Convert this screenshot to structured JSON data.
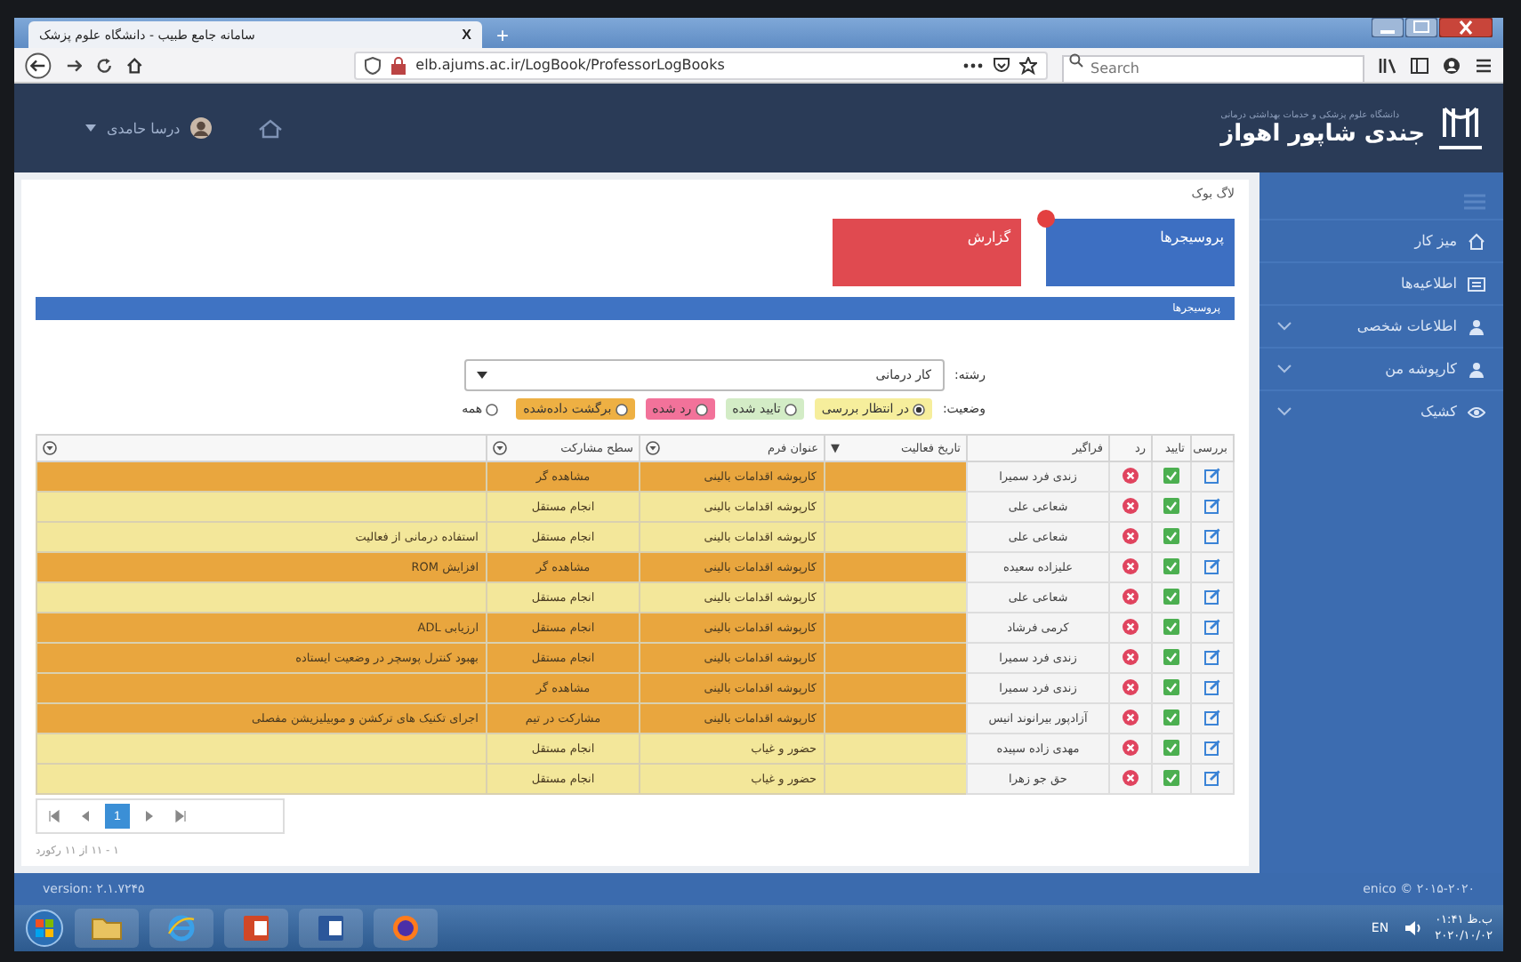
{
  "browser": {
    "tab_title": "سامانه جامع طبیب - دانشگاه علوم پزشک",
    "tab_close": "X",
    "new_tab": "+",
    "address": "elb.ajums.ac.ir/LogBook/ProfessorLogBooks",
    "search": {
      "placeholder": "Search"
    }
  },
  "header": {
    "user_name": "درسا حامدی",
    "org_line": "دانشگاه علوم پزشکی و خدمات بهداشتی درمانی",
    "org_name": "جندی شاپور اهواز"
  },
  "sidebar": {
    "items": [
      {
        "label": "میز کار",
        "expandable": false
      },
      {
        "label": "اطلاعیه‌ها",
        "expandable": false
      },
      {
        "label": "اطلاعات شخصی",
        "expandable": true
      },
      {
        "label": "کارپوشه من",
        "expandable": true
      },
      {
        "label": "کشیک",
        "expandable": true
      }
    ]
  },
  "breadcrumb": "لاگ بوک",
  "tiles": [
    {
      "label": "پروسیجرها",
      "color": "#3d6fc2",
      "badge": true
    },
    {
      "label": "گزارش",
      "color": "#e04a50",
      "badge": false
    }
  ],
  "section_title": "پروسیجرها",
  "filters": {
    "field_label": "رشته:",
    "field_value": "کار درمانی",
    "status_label": "وضعیت:",
    "status_options": [
      {
        "label": "در انتظار بررسی",
        "selected": true,
        "color": "#f6ee9c"
      },
      {
        "label": "تایید شده",
        "selected": false,
        "color": "#d3ecc6"
      },
      {
        "label": "رد شده",
        "selected": false,
        "color": "#f2729a"
      },
      {
        "label": "برگشت داده‌شده",
        "selected": false,
        "color": "#eeb043"
      },
      {
        "label": "همه",
        "selected": false
      }
    ]
  },
  "table": {
    "columns": [
      {
        "label": "بررسی"
      },
      {
        "label": "تایید"
      },
      {
        "label": "رد"
      },
      {
        "label": "فراگیر"
      },
      {
        "label": "تاریخ فعالیت",
        "sort": "▼"
      },
      {
        "label": "عنوان فرم",
        "filter": true
      },
      {
        "label": "سطح مشارکت",
        "filter": true
      },
      {
        "filter": true
      }
    ],
    "rows": [
      {
        "learner": "زندی فرد سمیرا",
        "form": "کارپوشه اقدامات بالینی",
        "participation": "مشاهده گر",
        "color": "#e9a63e"
      },
      {
        "learner": "شعاعی علی",
        "form": "کارپوشه اقدامات بالینی",
        "participation": "انجام مستقل",
        "color": "#f3e79a"
      },
      {
        "learner": "شعاعی علی",
        "form": "کارپوشه اقدامات بالینی",
        "participation": "انجام مستقل",
        "column_8": "استفاده درمانی از فعالیت",
        "color": "#f3e79a"
      },
      {
        "learner": "علیزاده سعیده",
        "form": "کارپوشه اقدامات بالینی",
        "participation": "مشاهده گر",
        "column_8": "افزایش ROM",
        "color": "#e9a63e"
      },
      {
        "learner": "شعاعی علی",
        "form": "کارپوشه اقدامات بالینی",
        "participation": "انجام مستقل",
        "color": "#f3e79a"
      },
      {
        "learner": "کرمی فرشاد",
        "form": "کارپوشه اقدامات بالینی",
        "participation": "انجام مستقل",
        "column_8": "ارزیابی ADL",
        "color": "#e9a63e"
      },
      {
        "learner": "زندی فرد سمیرا",
        "form": "کارپوشه اقدامات بالینی",
        "participation": "انجام مستقل",
        "column_8": "بهبود کنترل پوسچر در وضعیت ایستاده",
        "color": "#e9a63e"
      },
      {
        "learner": "زندی فرد سمیرا",
        "form": "کارپوشه اقدامات بالینی",
        "participation": "مشاهده گر",
        "color": "#e9a63e"
      },
      {
        "learner": "آزادپور بیرانوند انیس",
        "form": "کارپوشه اقدامات بالینی",
        "participation": "مشارکت در تیم",
        "column_8": "اجرای تکنیک های ترکشن و موبیلیزیشن مفصلی",
        "color": "#e9a63e"
      },
      {
        "learner": "مهدی زاده سپیده",
        "form": "حضور و غیاب",
        "participation": "انجام مستقل",
        "color": "#f3e79a"
      },
      {
        "learner": "حق جو زهرا",
        "form": "حضور و غیاب",
        "participation": "انجام مستقل",
        "color": "#f3e79a"
      }
    ]
  },
  "pagination": {
    "pages": [
      {
        "label": "1",
        "selected": true
      }
    ]
  },
  "record_count": "۱ - ۱۱ از ۱۱ رکورد",
  "status_bar": {
    "version": "version: ۲.۱.۷۲۴۵",
    "copyright": "enico © ۲۰۱۵-۲۰۲۰"
  },
  "taskbar": {
    "language": "EN",
    "time": "۰۱:۴۱ ب.ظ",
    "date": "۲۰۲۰/۱۰/۰۲"
  }
}
